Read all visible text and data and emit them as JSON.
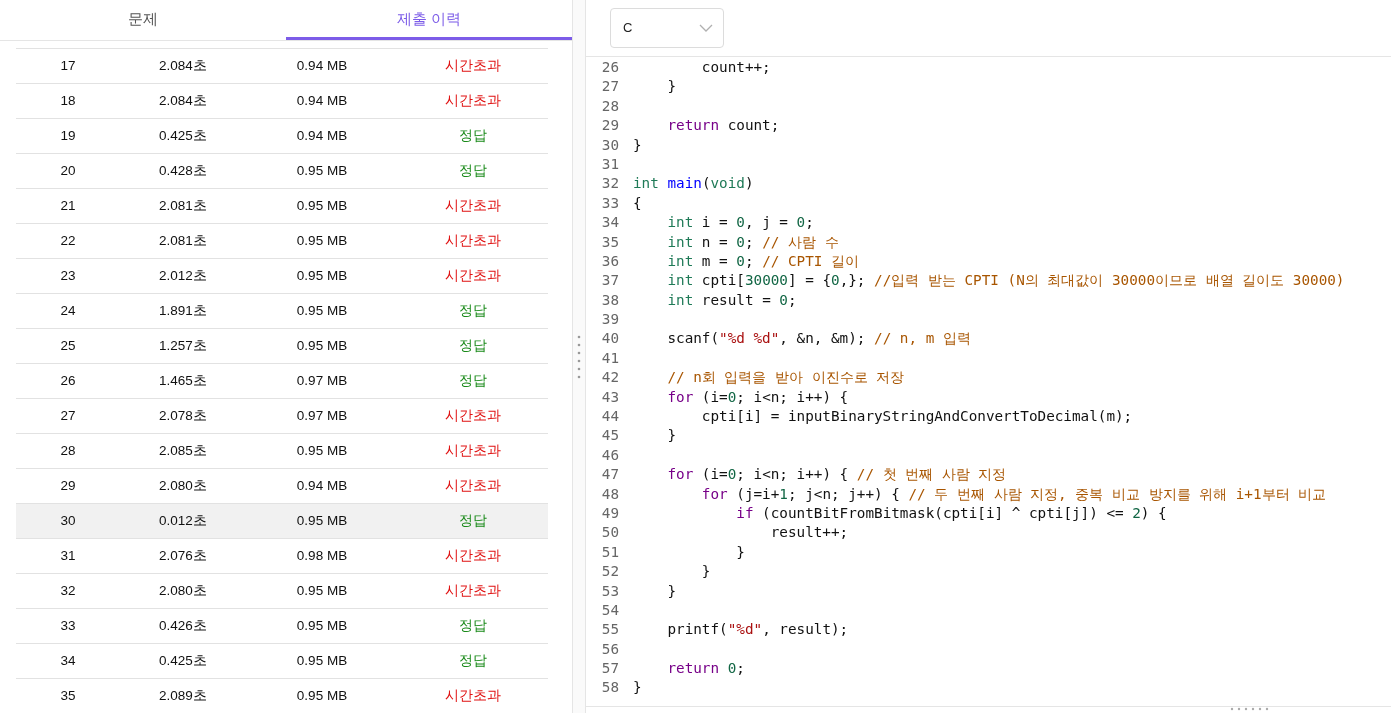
{
  "tabs": [
    {
      "label": "문제",
      "selected": false
    },
    {
      "label": "제출 이력",
      "selected": true
    }
  ],
  "submissions": {
    "rows": [
      {
        "number": "17",
        "time": "2.084초",
        "memory": "0.94 MB",
        "result": "시간초과",
        "kind": "tle",
        "selected": false
      },
      {
        "number": "18",
        "time": "2.084초",
        "memory": "0.94 MB",
        "result": "시간초과",
        "kind": "tle",
        "selected": false
      },
      {
        "number": "19",
        "time": "0.425초",
        "memory": "0.94 MB",
        "result": "정답",
        "kind": "ok",
        "selected": false
      },
      {
        "number": "20",
        "time": "0.428초",
        "memory": "0.95 MB",
        "result": "정답",
        "kind": "ok",
        "selected": false
      },
      {
        "number": "21",
        "time": "2.081초",
        "memory": "0.95 MB",
        "result": "시간초과",
        "kind": "tle",
        "selected": false
      },
      {
        "number": "22",
        "time": "2.081초",
        "memory": "0.95 MB",
        "result": "시간초과",
        "kind": "tle",
        "selected": false
      },
      {
        "number": "23",
        "time": "2.012초",
        "memory": "0.95 MB",
        "result": "시간초과",
        "kind": "tle",
        "selected": false
      },
      {
        "number": "24",
        "time": "1.891초",
        "memory": "0.95 MB",
        "result": "정답",
        "kind": "ok",
        "selected": false
      },
      {
        "number": "25",
        "time": "1.257초",
        "memory": "0.95 MB",
        "result": "정답",
        "kind": "ok",
        "selected": false
      },
      {
        "number": "26",
        "time": "1.465초",
        "memory": "0.97 MB",
        "result": "정답",
        "kind": "ok",
        "selected": false
      },
      {
        "number": "27",
        "time": "2.078초",
        "memory": "0.97 MB",
        "result": "시간초과",
        "kind": "tle",
        "selected": false
      },
      {
        "number": "28",
        "time": "2.085초",
        "memory": "0.95 MB",
        "result": "시간초과",
        "kind": "tle",
        "selected": false
      },
      {
        "number": "29",
        "time": "2.080초",
        "memory": "0.94 MB",
        "result": "시간초과",
        "kind": "tle",
        "selected": false
      },
      {
        "number": "30",
        "time": "0.012초",
        "memory": "0.95 MB",
        "result": "정답",
        "kind": "ok",
        "selected": true
      },
      {
        "number": "31",
        "time": "2.076초",
        "memory": "0.98 MB",
        "result": "시간초과",
        "kind": "tle",
        "selected": false
      },
      {
        "number": "32",
        "time": "2.080초",
        "memory": "0.95 MB",
        "result": "시간초과",
        "kind": "tle",
        "selected": false
      },
      {
        "number": "33",
        "time": "0.426초",
        "memory": "0.95 MB",
        "result": "정답",
        "kind": "ok",
        "selected": false
      },
      {
        "number": "34",
        "time": "0.425초",
        "memory": "0.95 MB",
        "result": "정답",
        "kind": "ok",
        "selected": false
      },
      {
        "number": "35",
        "time": "2.089초",
        "memory": "0.95 MB",
        "result": "시간초과",
        "kind": "tle",
        "selected": false
      }
    ]
  },
  "language_select": {
    "value": "C"
  },
  "code": {
    "lines": [
      {
        "number": "26",
        "tokens": [
          {
            "kind": "plain",
            "text": "        count++;"
          }
        ]
      },
      {
        "number": "27",
        "tokens": [
          {
            "kind": "plain",
            "text": "    }"
          }
        ]
      },
      {
        "number": "28"
      },
      {
        "number": "29",
        "tokens": [
          {
            "kind": "keyword",
            "text": "    return"
          },
          {
            "kind": "plain",
            "text": " count;"
          }
        ]
      },
      {
        "number": "30",
        "tokens": [
          {
            "kind": "plain",
            "text": "}"
          }
        ]
      },
      {
        "number": "31"
      },
      {
        "number": "32",
        "tokens": [
          {
            "kind": "type",
            "text": "int"
          },
          {
            "kind": "function",
            "text": " main"
          },
          {
            "kind": "plain",
            "text": "("
          },
          {
            "kind": "type",
            "text": "void"
          },
          {
            "kind": "plain",
            "text": ")"
          }
        ]
      },
      {
        "number": "33",
        "tokens": [
          {
            "kind": "plain",
            "text": "{"
          }
        ]
      },
      {
        "number": "34",
        "tokens": [
          {
            "kind": "type",
            "text": "    int"
          },
          {
            "kind": "plain",
            "text": " i = "
          },
          {
            "kind": "number",
            "text": "0"
          },
          {
            "kind": "plain",
            "text": ", j = "
          },
          {
            "kind": "number",
            "text": "0"
          },
          {
            "kind": "plain",
            "text": ";"
          }
        ]
      },
      {
        "number": "35",
        "tokens": [
          {
            "kind": "type",
            "text": "    int"
          },
          {
            "kind": "plain",
            "text": " n = "
          },
          {
            "kind": "number",
            "text": "0"
          },
          {
            "kind": "plain",
            "text": ";"
          },
          {
            "kind": "comment",
            "text": " // 사람 수"
          }
        ]
      },
      {
        "number": "36",
        "tokens": [
          {
            "kind": "type",
            "text": "    int"
          },
          {
            "kind": "plain",
            "text": " m = "
          },
          {
            "kind": "number",
            "text": "0"
          },
          {
            "kind": "plain",
            "text": ";"
          },
          {
            "kind": "comment",
            "text": " // CPTI 길이"
          }
        ]
      },
      {
        "number": "37",
        "tokens": [
          {
            "kind": "type",
            "text": "    int"
          },
          {
            "kind": "plain",
            "text": " cpti["
          },
          {
            "kind": "number",
            "text": "30000"
          },
          {
            "kind": "plain",
            "text": "] = {"
          },
          {
            "kind": "number",
            "text": "0"
          },
          {
            "kind": "plain",
            "text": ",};"
          },
          {
            "kind": "comment",
            "text": " //입력 받는 CPTI (N의 최대값이 30000이므로 배열 길이도 30000)"
          }
        ]
      },
      {
        "number": "38",
        "tokens": [
          {
            "kind": "type",
            "text": "    int"
          },
          {
            "kind": "plain",
            "text": " result = "
          },
          {
            "kind": "number",
            "text": "0"
          },
          {
            "kind": "plain",
            "text": ";"
          }
        ]
      },
      {
        "number": "39"
      },
      {
        "number": "40",
        "tokens": [
          {
            "kind": "plain",
            "text": "    scanf("
          },
          {
            "kind": "string",
            "text": "\"%d %d\""
          },
          {
            "kind": "plain",
            "text": ", &n, &m);"
          },
          {
            "kind": "comment",
            "text": " // n, m 입력"
          }
        ]
      },
      {
        "number": "41"
      },
      {
        "number": "42",
        "tokens": [
          {
            "kind": "comment",
            "text": "    // n회 입력을 받아 이진수로 저장"
          }
        ]
      },
      {
        "number": "43",
        "tokens": [
          {
            "kind": "keyword",
            "text": "    for"
          },
          {
            "kind": "plain",
            "text": " (i="
          },
          {
            "kind": "number",
            "text": "0"
          },
          {
            "kind": "plain",
            "text": "; i<n; i++) {"
          }
        ]
      },
      {
        "number": "44",
        "tokens": [
          {
            "kind": "plain",
            "text": "        cpti[i] = inputBinaryStringAndConvertToDecimal(m);"
          }
        ]
      },
      {
        "number": "45",
        "tokens": [
          {
            "kind": "plain",
            "text": "    }"
          }
        ]
      },
      {
        "number": "46"
      },
      {
        "number": "47",
        "tokens": [
          {
            "kind": "keyword",
            "text": "    for"
          },
          {
            "kind": "plain",
            "text": " (i="
          },
          {
            "kind": "number",
            "text": "0"
          },
          {
            "kind": "plain",
            "text": "; i<n; i++) {"
          },
          {
            "kind": "comment",
            "text": " // 첫 번째 사람 지정"
          }
        ]
      },
      {
        "number": "48",
        "tokens": [
          {
            "kind": "keyword",
            "text": "        for"
          },
          {
            "kind": "plain",
            "text": " (j=i+"
          },
          {
            "kind": "number",
            "text": "1"
          },
          {
            "kind": "plain",
            "text": "; j<n; j++) {"
          },
          {
            "kind": "comment",
            "text": " // 두 번째 사람 지정, 중복 비교 방지를 위해 i+1부터 비교"
          }
        ]
      },
      {
        "number": "49",
        "tokens": [
          {
            "kind": "keyword",
            "text": "            if"
          },
          {
            "kind": "plain",
            "text": " (countBitFromBitmask(cpti[i] ^ cpti[j]) <= "
          },
          {
            "kind": "number",
            "text": "2"
          },
          {
            "kind": "plain",
            "text": ") {"
          }
        ]
      },
      {
        "number": "50",
        "tokens": [
          {
            "kind": "plain",
            "text": "                result++;"
          }
        ]
      },
      {
        "number": "51",
        "tokens": [
          {
            "kind": "plain",
            "text": "            }"
          }
        ]
      },
      {
        "number": "52",
        "tokens": [
          {
            "kind": "plain",
            "text": "        }"
          }
        ]
      },
      {
        "number": "53",
        "tokens": [
          {
            "kind": "plain",
            "text": "    }"
          }
        ]
      },
      {
        "number": "54"
      },
      {
        "number": "55",
        "tokens": [
          {
            "kind": "plain",
            "text": "    printf("
          },
          {
            "kind": "string",
            "text": "\"%d\""
          },
          {
            "kind": "plain",
            "text": ", result);"
          }
        ]
      },
      {
        "number": "56"
      },
      {
        "number": "57",
        "tokens": [
          {
            "kind": "keyword",
            "text": "    return"
          },
          {
            "kind": "number",
            "text": " 0"
          },
          {
            "kind": "plain",
            "text": ";"
          }
        ]
      },
      {
        "number": "58",
        "tokens": [
          {
            "kind": "plain",
            "text": "}"
          }
        ]
      }
    ]
  }
}
